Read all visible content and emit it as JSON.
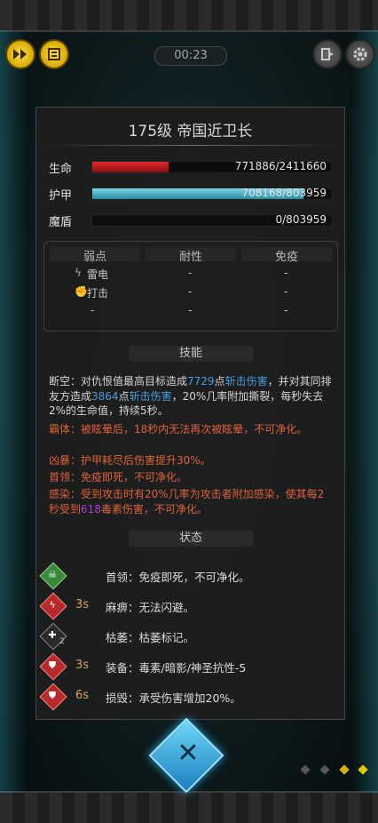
{
  "timer": "00:23",
  "colors": {
    "hp": "#c0141c",
    "armor": "#4fb2c4",
    "shield": "#0d0d0d",
    "orange_text": "#e0623a",
    "blue_text": "#4a9be0",
    "purple_text": "#b040d0",
    "gold_button": "#e6c000"
  },
  "icons": {
    "fast_forward": "fast-forward-icon",
    "menu": "menu-icon",
    "exit": "exit-icon",
    "settings": "gear-icon"
  },
  "boss": {
    "title": "175级  帝国近卫长"
  },
  "stats": [
    {
      "label": "生命",
      "text": "771886/2411660",
      "fill": 0.32
    },
    {
      "label": "护甲",
      "text": "708168/803959",
      "fill": 0.88
    },
    {
      "label": "魔盾",
      "text": "0/803959",
      "fill": 0.0
    }
  ],
  "resist_table": {
    "headers": [
      "弱点",
      "耐性",
      "免疫"
    ],
    "weakness": [
      "雷电",
      "打击",
      "-"
    ],
    "resistance": [
      "-",
      "-",
      "-"
    ],
    "immunity": [
      "-",
      "-",
      "-"
    ]
  },
  "skills_header": "技能",
  "skills": {
    "s1_name": "断空：",
    "s1_a": "对仇恨值最高目标造成",
    "s1_num1": "7729",
    "s1_b": "点",
    "s1_dmg1": "斩击伤害",
    "s1_c": "，并对其同排友方造成",
    "s1_num2": "3864",
    "s1_d": "点",
    "s1_dmg2": "斩击伤害",
    "s1_e": "，20%几率附加撕裂，每秒失去2%的生命值，持续5秒。",
    "s2": "霸体：被眩晕后，18秒内无法再次被眩晕，不可净化。",
    "s3": "凶暴：护甲耗尽后伤害提升30%。",
    "s4_name": "首领：",
    "s4": "免疫即死，不可净化。",
    "s5_a": "感染：受到攻击时有20%几率为攻击者附加感染，使其每2秒受到",
    "s5_num": "618",
    "s5_b": "毒素伤害，不可净化。"
  },
  "status_header": "状态",
  "statuses": [
    {
      "icon": "skull-icon",
      "time": "",
      "text": "首领：免疫即死，不可净化。",
      "color": "#3a8a3a"
    },
    {
      "icon": "paralysis-icon",
      "time": "3s",
      "text": "麻痹：无法闪避。",
      "color": "#b82a2a"
    },
    {
      "icon": "wither-icon",
      "time": "",
      "stack": "2",
      "text": "枯萎：枯萎标记。",
      "color": "#2a2a2a"
    },
    {
      "icon": "shield-icon",
      "time": "3s",
      "text": "装备：毒素/暗影/神圣抗性-5",
      "color": "#b82a2a"
    },
    {
      "icon": "shield-icon",
      "time": "6s",
      "text": "损毁：承受伤害增加20%。",
      "color": "#b82a2a"
    }
  ],
  "close_label": "✕"
}
